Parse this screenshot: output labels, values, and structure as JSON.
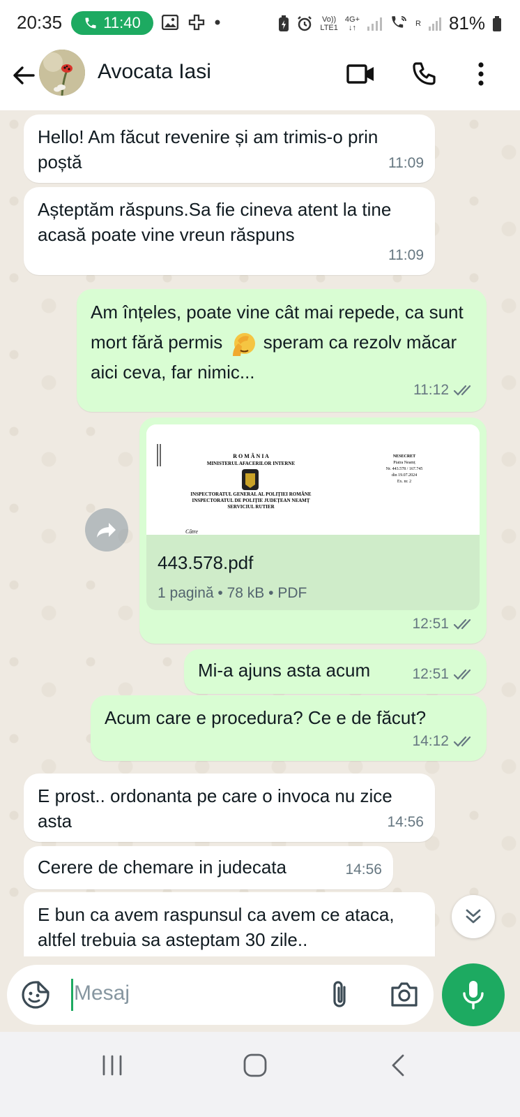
{
  "status_bar": {
    "time": "20:35",
    "call_duration": "11:40",
    "network_volte": "Vo))",
    "network_lte": "LTE1",
    "network_4g": "4G+",
    "sim2_label": "R",
    "battery": "81%"
  },
  "header": {
    "contact_name": "Avocata Iasi"
  },
  "messages": [
    {
      "direction": "in",
      "text": "Hello! Am făcut revenire și am trimis-o prin poștă",
      "time": "11:09"
    },
    {
      "direction": "in",
      "text": "Așteptăm răspuns.Sa fie cineva atent la tine acasă poate vine vreun răspuns",
      "time": "11:09"
    },
    {
      "direction": "out",
      "text_before_emoji": "Am înțeles, poate vine cât mai repede, ca sunt mort fără permis",
      "emoji": "face-palm",
      "text_after_emoji": "speram ca rezolv măcar aici ceva, far nimic...",
      "time": "11:12",
      "status": "read"
    },
    {
      "direction": "out",
      "type": "document",
      "document": {
        "name": "443.578.pdf",
        "details": "1 pagină • 78 kB • PDF"
      },
      "time": "12:51",
      "status": "read"
    },
    {
      "direction": "out",
      "text": "Mi-a ajuns asta acum",
      "time": "12:51",
      "status": "read"
    },
    {
      "direction": "out",
      "text": "Acum care e procedura? Ce e de făcut?",
      "time": "14:12",
      "status": "read"
    },
    {
      "direction": "in",
      "text": "E prost.. ordonanta pe care o invoca nu zice asta",
      "time": "14:56"
    },
    {
      "direction": "in",
      "text": "Cerere de chemare in judecata",
      "time": "14:56"
    },
    {
      "direction": "in",
      "text": "E bun ca avem raspunsul ca avem ce ataca, altfel trebuia sa asteptam 30 zile..",
      "time": ""
    }
  ],
  "document_preview": {
    "country": "R O M Â N I A",
    "ministry": "MINISTERUL AFACERILOR INTERNE",
    "inspectorate_general": "INSPECTORATUL GENERAL AL POLIȚIEI ROMÂNE",
    "inspectorate_county": "INSPECTORATUL DE POLIȚIE JUDEȚEAN NEAMȚ",
    "service": "SERVICIUL RUTIER",
    "classification": "NESECRET",
    "city": "Piatra Neamț",
    "registration_number": "Nr. 443.578 / 167.745",
    "date": "din 19.07.2024",
    "copy": "Ex. nr. 2",
    "addressee": "Către"
  },
  "composer": {
    "placeholder": "Mesaj"
  },
  "colors": {
    "accent": "#1daa61",
    "outgoing_bubble": "#d9fdd3",
    "incoming_bubble": "#ffffff",
    "chat_background": "#efeae2",
    "read_tick": "#53bdeb"
  }
}
